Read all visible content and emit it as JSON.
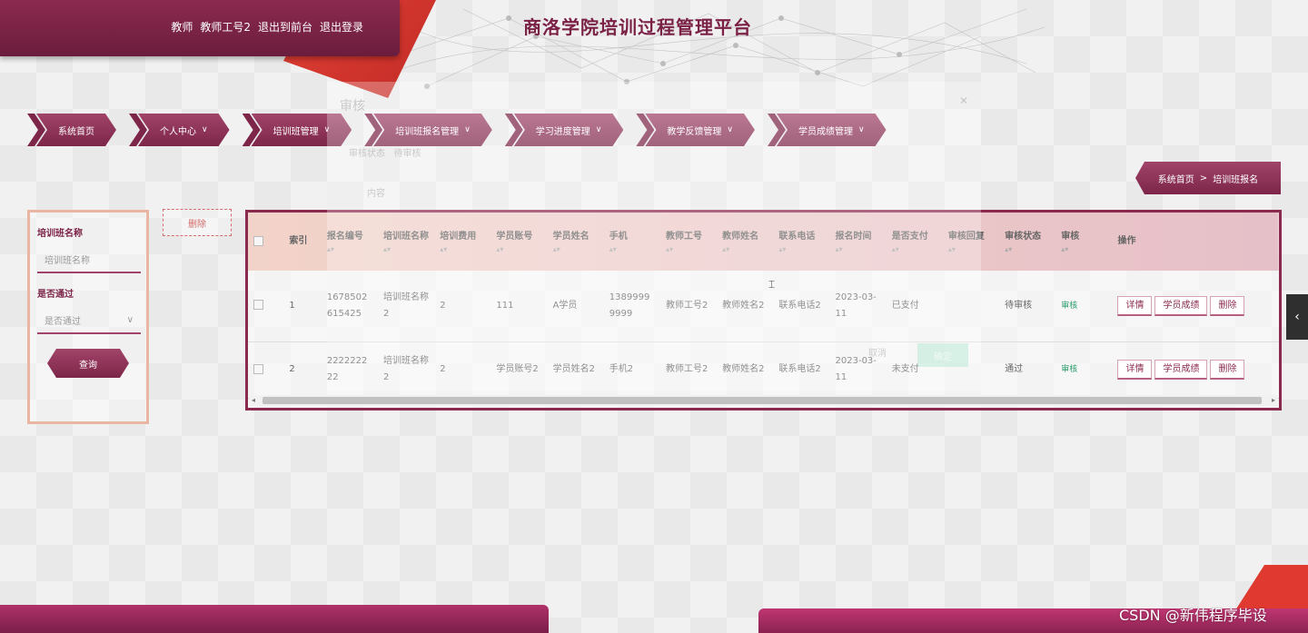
{
  "header": {
    "role": "教师",
    "user": "教师工号2",
    "front_link": "退出到前台",
    "logout_link": "退出登录",
    "site_title": "商洛学院培训过程管理平台"
  },
  "nav": {
    "items": [
      {
        "label": "系统首页",
        "has_dropdown": false
      },
      {
        "label": "个人中心",
        "has_dropdown": true
      },
      {
        "label": "培训班管理",
        "has_dropdown": true
      },
      {
        "label": "培训班报名管理",
        "has_dropdown": true
      },
      {
        "label": "学习进度管理",
        "has_dropdown": true
      },
      {
        "label": "教学反馈管理",
        "has_dropdown": true
      },
      {
        "label": "学员成绩管理",
        "has_dropdown": true
      }
    ]
  },
  "breadcrumb": {
    "home": "系统首页",
    "separator": ">",
    "current": "培训班报名"
  },
  "search": {
    "name_label": "培训班名称",
    "name_placeholder": "培训班名称",
    "pass_label": "是否通过",
    "pass_placeholder": "是否通过",
    "query_button": "查询"
  },
  "actions": {
    "delete_label": "删除"
  },
  "table": {
    "headers": [
      "索引",
      "报名编号",
      "培训班名称",
      "培训费用",
      "学员账号",
      "学员姓名",
      "手机",
      "教师工号",
      "教师姓名",
      "联系电话",
      "报名时间",
      "是否支付",
      "审核回复",
      "审核状态",
      "审核",
      "操作"
    ],
    "rows": [
      {
        "index": "1",
        "reg_no": "1678502615425",
        "class_name": "培训班名称2",
        "fee": "2",
        "account": "111",
        "student": "A学员",
        "phone": "13899999999",
        "teacher_no": "教师工号2",
        "teacher_name": "教师姓名2",
        "contact": "联系电话2",
        "date": "2023-03-11",
        "paid": "已支付",
        "reply": "",
        "status": "待审核",
        "review": "审核"
      },
      {
        "index": "2",
        "reg_no": "222222222",
        "class_name": "培训班名称2",
        "fee": "2",
        "account": "学员账号2",
        "student": "学员姓名2",
        "phone": "手机2",
        "teacher_no": "教师工号2",
        "teacher_name": "教师姓名2",
        "contact": "联系电话2",
        "date": "2023-03-11",
        "paid": "未支付",
        "reply": "",
        "status": "通过",
        "review": "审核"
      }
    ],
    "op_buttons": {
      "detail": "详情",
      "score": "学员成绩",
      "delete": "删除"
    }
  },
  "ghost_modal": {
    "title": "审核",
    "status_label": "审核状态",
    "status_value": "待审核",
    "content_label": "内容",
    "cancel": "取消",
    "ok": "确定"
  },
  "watermark": "CSDN @新伟程序毕设",
  "colors": {
    "brand": "#7d2649",
    "accent_red": "#e03a30",
    "review_green": "#2a9d6a"
  }
}
